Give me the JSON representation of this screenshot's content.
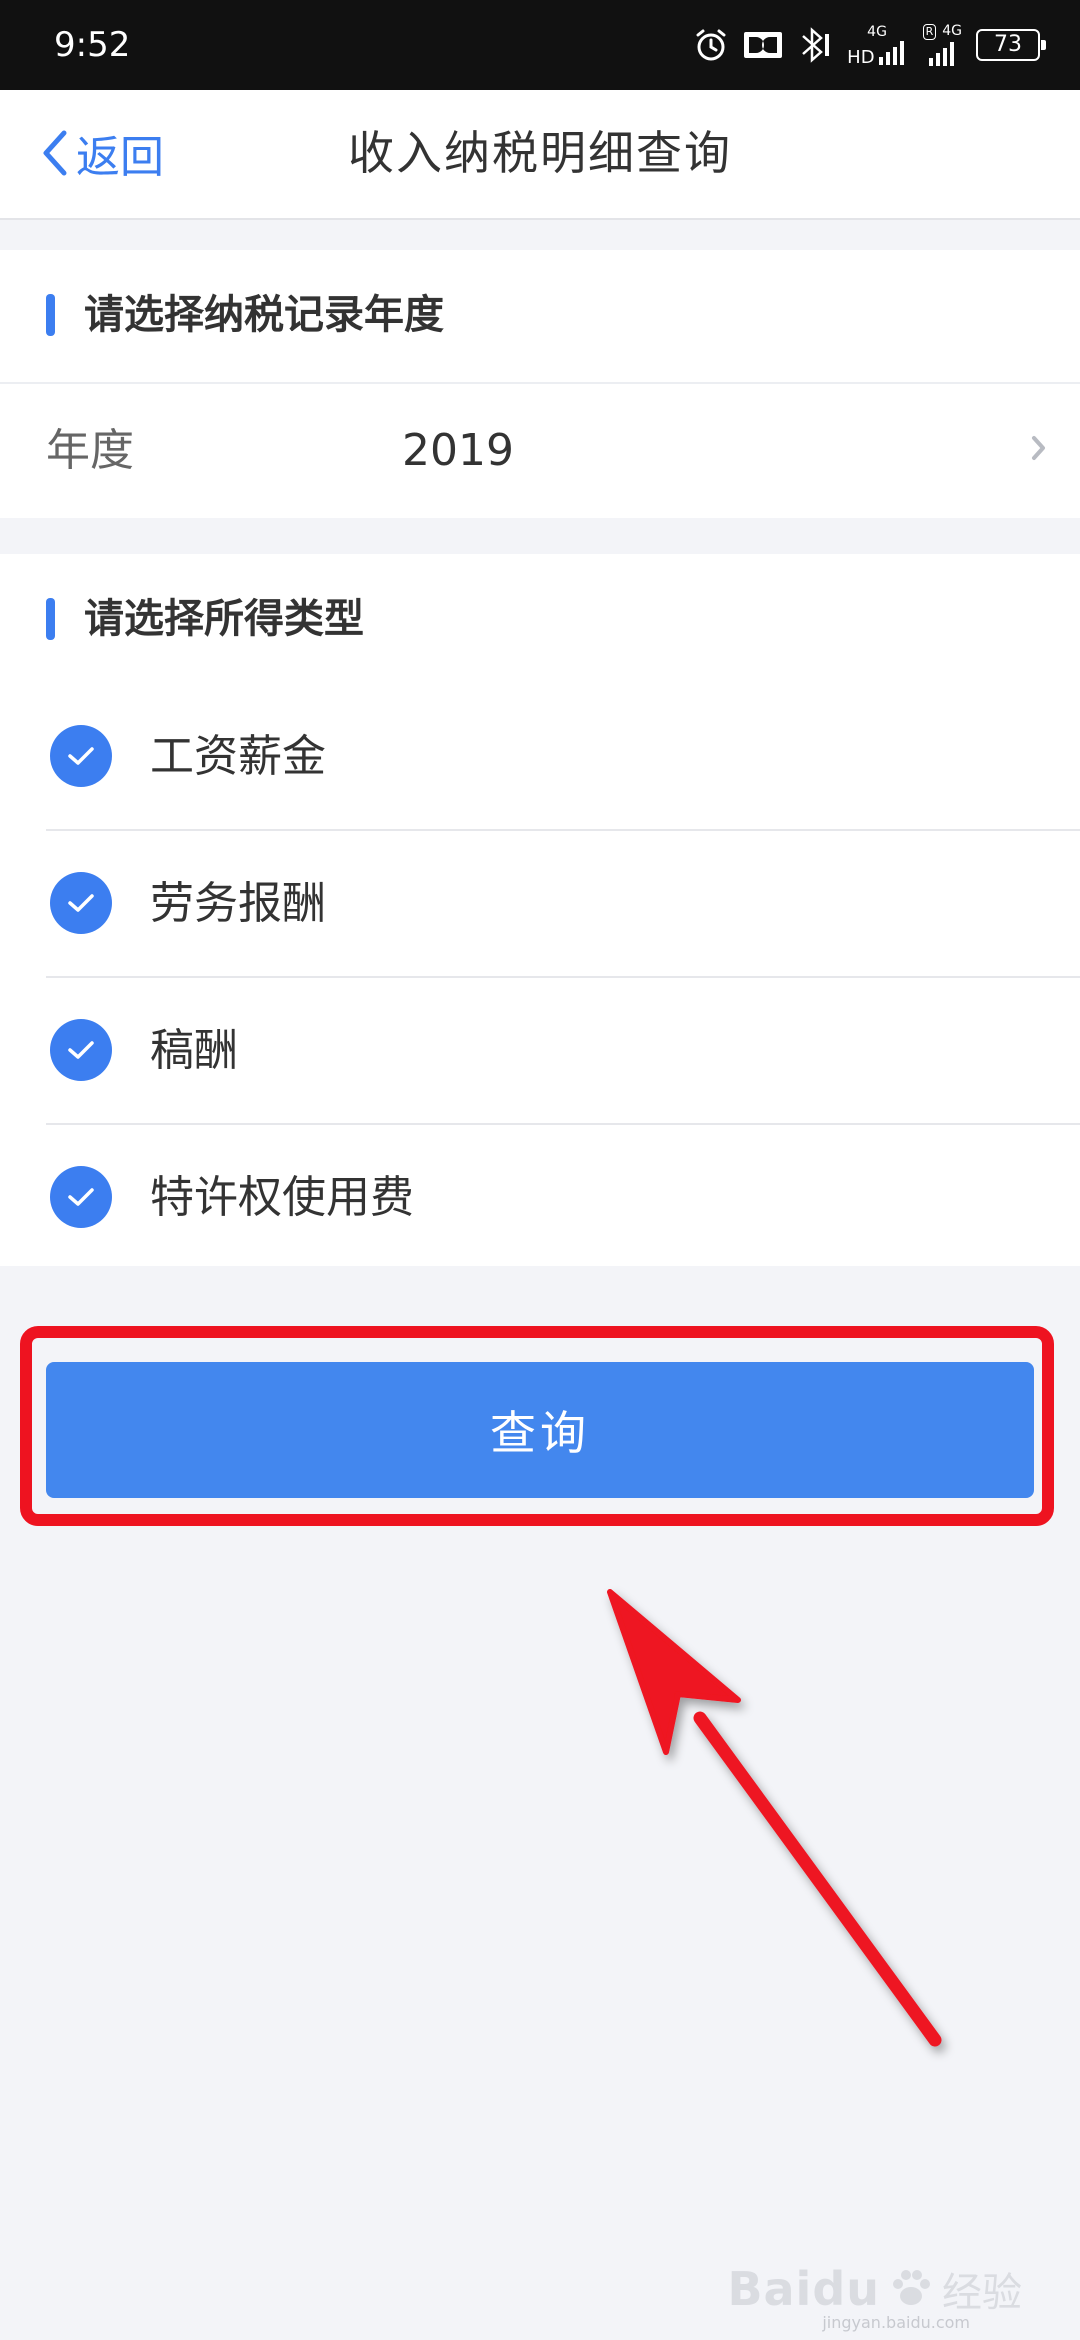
{
  "status_bar": {
    "time": "9:52",
    "network_1": "4G",
    "network_hd": "HD",
    "network_2": "4G",
    "roaming": "R",
    "battery": "73",
    "icons": [
      "alarm-icon",
      "dolby-icon",
      "bluetooth-icon",
      "signal-icon",
      "signal-icon",
      "battery-icon"
    ]
  },
  "nav": {
    "back_label": "返回",
    "title": "收入纳税明细查询"
  },
  "year_section": {
    "title": "请选择纳税记录年度",
    "label": "年度",
    "value": "2019"
  },
  "income_section": {
    "title": "请选择所得类型",
    "items": [
      {
        "label": "工资薪金",
        "checked": true
      },
      {
        "label": "劳务报酬",
        "checked": true
      },
      {
        "label": "稿酬",
        "checked": true
      },
      {
        "label": "特许权使用费",
        "checked": true
      }
    ]
  },
  "query_button": {
    "label": "查询"
  },
  "colors": {
    "accent": "#3c7ef0",
    "button": "#4387ee",
    "annotation": "#ee1320",
    "background": "#f3f4f8"
  },
  "watermark": {
    "brand": "Baidu",
    "cn": "经验",
    "url": "jingyan.baidu.com"
  }
}
